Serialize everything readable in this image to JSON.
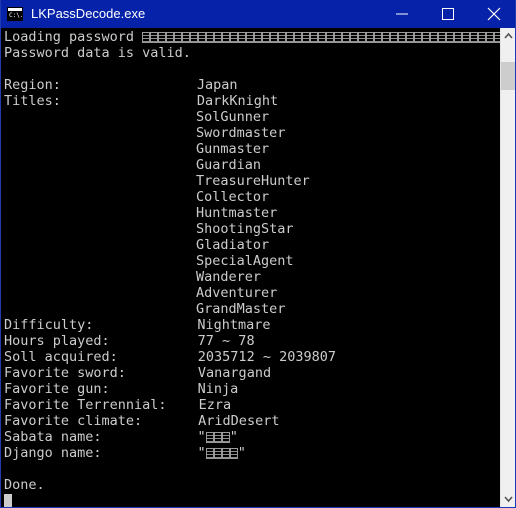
{
  "window": {
    "title": "LKPassDecode.exe",
    "icon_name": "console-app-icon",
    "icon_prompt_text": "C:\\.",
    "titlebar_color": "#0622a8",
    "border_color": "#1f3ab5",
    "background_color": "#000000",
    "text_color": "#cccccc",
    "controls": [
      {
        "name": "minimize-button",
        "label": "—"
      },
      {
        "name": "maximize-button",
        "label": "☐"
      },
      {
        "name": "close-button",
        "label": "✕"
      }
    ]
  },
  "scrollbar": {
    "up_arrow_label": "⌃",
    "down_arrow_label": "⌄",
    "thumb_position_percent": 4
  },
  "console": {
    "lines": [
      {
        "label": "Loading password ",
        "tofu": 45,
        "suffix": "..."
      },
      {
        "label": "Password data is valid."
      },
      {
        "label": ""
      },
      {
        "label": "Region:",
        "value": "Japan"
      },
      {
        "label": "Titles:",
        "value": "DarkKnight"
      },
      {
        "label": "",
        "value": "SolGunner"
      },
      {
        "label": "",
        "value": "Swordmaster"
      },
      {
        "label": "",
        "value": "Gunmaster"
      },
      {
        "label": "",
        "value": "Guardian"
      },
      {
        "label": "",
        "value": "TreasureHunter"
      },
      {
        "label": "",
        "value": "Collector"
      },
      {
        "label": "",
        "value": "Huntmaster"
      },
      {
        "label": "",
        "value": "ShootingStar"
      },
      {
        "label": "",
        "value": "Gladiator"
      },
      {
        "label": "",
        "value": "SpecialAgent"
      },
      {
        "label": "",
        "value": "Wanderer"
      },
      {
        "label": "",
        "value": "Adventurer"
      },
      {
        "label": "",
        "value": "GrandMaster"
      },
      {
        "label": "Difficulty:",
        "value": "Nightmare"
      },
      {
        "label": "Hours played:",
        "value": "77 ~ 78"
      },
      {
        "label": "Soll acquired:",
        "value": "2035712 ~ 2039807"
      },
      {
        "label": "Favorite sword:",
        "value": "Vanargand"
      },
      {
        "label": "Favorite gun:",
        "value": "Ninja"
      },
      {
        "label": "Favorite Terrennial:",
        "value": "Ezra"
      },
      {
        "label": "Favorite climate:",
        "value": "AridDesert"
      },
      {
        "label": "Sabata name:",
        "value_prefix": "\"",
        "tofu": 3,
        "value_suffix": "\""
      },
      {
        "label": "Django name:",
        "value_prefix": "\"",
        "tofu": 4,
        "value_suffix": "\""
      },
      {
        "label": ""
      },
      {
        "label": "Done."
      }
    ],
    "value_column": 24,
    "cursor_line_index": 29
  }
}
